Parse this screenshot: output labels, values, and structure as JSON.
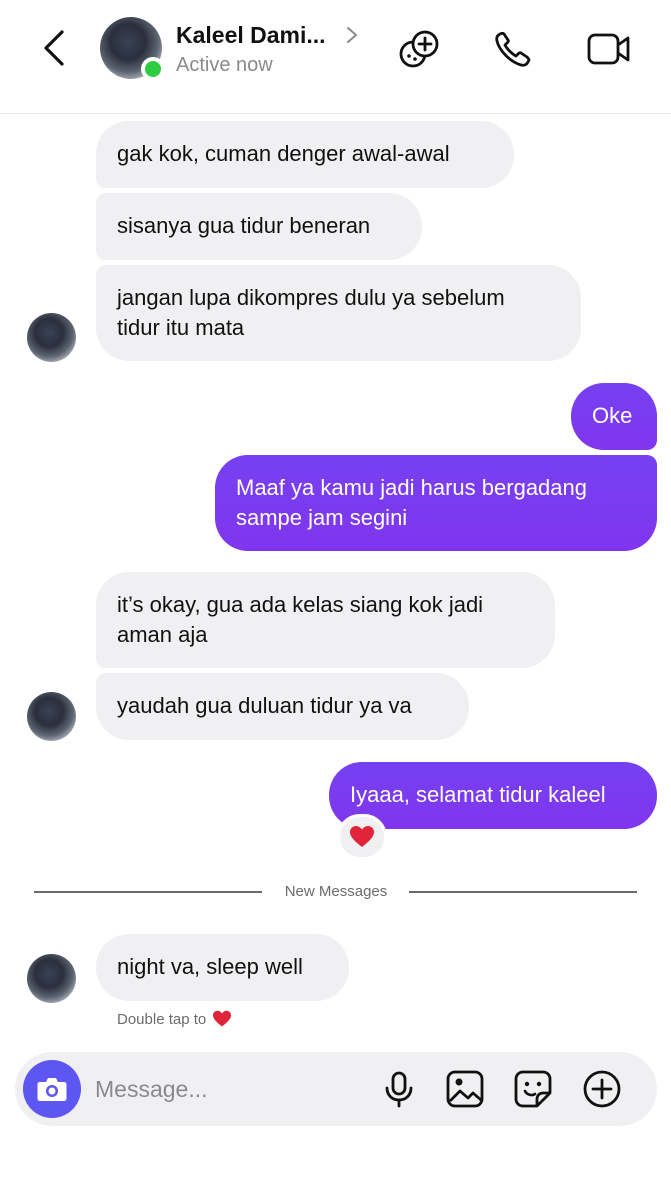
{
  "header": {
    "contact_name": "Kaleel Dami...",
    "status": "Active now"
  },
  "messages": [
    {
      "dir": "in",
      "lines": [
        "gak kok, cuman denger awal-awal"
      ]
    },
    {
      "dir": "in",
      "lines": [
        "sisanya gua tidur beneran"
      ]
    },
    {
      "dir": "in",
      "lines": [
        "jangan lupa dikompres dulu ya sebelum",
        "tidur itu mata"
      ]
    },
    {
      "dir": "out",
      "lines": [
        "Oke"
      ]
    },
    {
      "dir": "out",
      "lines": [
        "Maaf ya kamu jadi harus bergadang",
        "sampe jam segini"
      ]
    },
    {
      "dir": "in",
      "lines": [
        "it’s okay, gua ada kelas siang kok jadi",
        "aman aja"
      ]
    },
    {
      "dir": "in",
      "lines": [
        "yaudah gua duluan tidur ya va"
      ]
    },
    {
      "dir": "out",
      "lines": [
        "Iyaaa, selamat tidur kaleel"
      ],
      "reaction": "heart"
    },
    {
      "dir": "in",
      "lines": [
        "night va, sleep well"
      ]
    }
  ],
  "divider": {
    "label": "New Messages"
  },
  "hint": {
    "label": "Double tap to",
    "icon": "heart-icon"
  },
  "composer": {
    "placeholder": "Message..."
  },
  "colors": {
    "accent": "#7B3CF3",
    "camera": "#5D56F3",
    "online": "#2ECC40",
    "incoming_bubble": "#F0F0F2",
    "heart": "#E0243A"
  },
  "icons": [
    "back-arrow-icon",
    "chevron-right-icon",
    "games-icon",
    "phone-icon",
    "video-camera-icon",
    "camera-icon",
    "microphone-icon",
    "image-icon",
    "sticker-icon",
    "plus-circle-icon",
    "heart-icon"
  ]
}
